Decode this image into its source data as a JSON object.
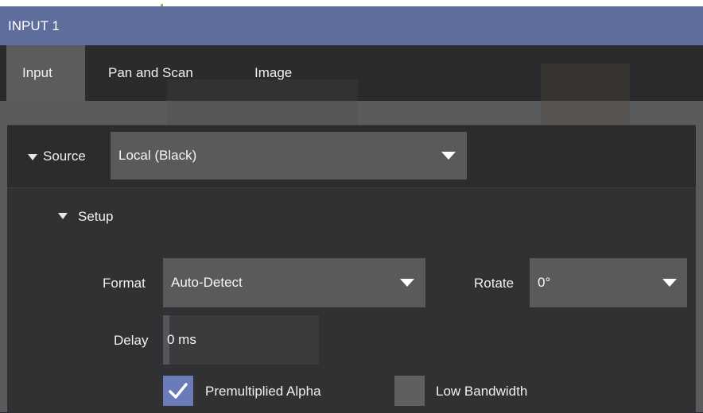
{
  "window": {
    "title": "INPUT 1"
  },
  "tabs": [
    {
      "label": "Input",
      "active": true
    },
    {
      "label": "Pan and Scan",
      "active": false
    },
    {
      "label": "Image",
      "active": false
    }
  ],
  "source": {
    "label": "Source",
    "value": "Local (Black)"
  },
  "setup": {
    "label": "Setup",
    "format": {
      "label": "Format",
      "value": "Auto-Detect"
    },
    "rotate": {
      "label": "Rotate",
      "value": "0°"
    },
    "delay": {
      "label": "Delay",
      "value": "0 ms"
    },
    "premultiplied_alpha": {
      "label": "Premultiplied Alpha",
      "checked": true
    },
    "low_bandwidth": {
      "label": "Low Bandwidth",
      "checked": false
    }
  },
  "colors": {
    "titlebar": "#5f6d9c",
    "accent": "#6b7ab8",
    "panel": "#313134"
  },
  "icons": [
    "collapse-triangle-icon",
    "dropdown-arrow-icon",
    "checkmark-icon"
  ]
}
